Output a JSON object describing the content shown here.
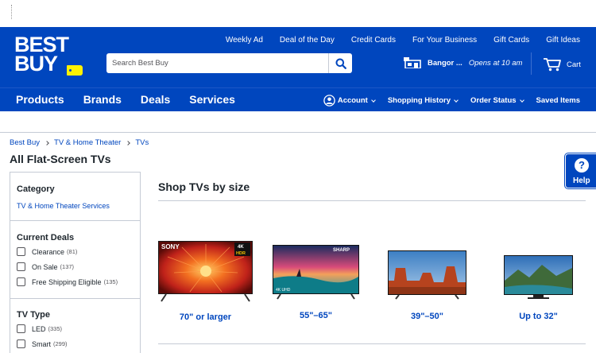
{
  "brand": {
    "logo_text_line1": "BEST",
    "logo_text_line2": "BUY",
    "brand_blue": "#0046be",
    "tag_yellow": "#fff200"
  },
  "utility_links": [
    "Weekly Ad",
    "Deal of the Day",
    "Credit Cards",
    "For Your Business",
    "Gift Cards",
    "Gift Ideas"
  ],
  "search": {
    "placeholder": "Search Best Buy",
    "button_icon": "search-icon"
  },
  "store": {
    "icon": "store-icon",
    "name": "Bangor ...",
    "hours": "Opens at 10 am"
  },
  "cart": {
    "icon": "cart-icon",
    "label": "Cart"
  },
  "nav": {
    "main": [
      "Products",
      "Brands",
      "Deals",
      "Services"
    ],
    "account": {
      "icon": "account-icon",
      "label": "Account"
    },
    "shopping_history": "Shopping History",
    "order_status": "Order Status",
    "saved_items": "Saved Items"
  },
  "breadcrumb": [
    "Best Buy",
    "TV & Home Theater",
    "TVs"
  ],
  "page_title": "All Flat-Screen TVs",
  "sidebar": {
    "category": {
      "title": "Category",
      "link": "TV & Home Theater Services"
    },
    "current_deals": {
      "title": "Current Deals",
      "options": [
        {
          "label": "Clearance",
          "count": "(81)"
        },
        {
          "label": "On Sale",
          "count": "(137)"
        },
        {
          "label": "Free Shipping Eligible",
          "count": "(135)"
        }
      ]
    },
    "tv_type": {
      "title": "TV Type",
      "options": [
        {
          "label": "LED",
          "count": "(335)"
        },
        {
          "label": "Smart",
          "count": "(299)"
        }
      ]
    }
  },
  "shop_by_size": {
    "title": "Shop TVs by size",
    "items": [
      {
        "label": "70\" or larger",
        "brand_text": "SONY",
        "badge_top": "4K",
        "badge_bottom": "HDR"
      },
      {
        "label": "55\"–65\"",
        "brand_text": "SHARP",
        "corner_text": "4K UHD"
      },
      {
        "label": "39\"–50\""
      },
      {
        "label": "Up to 32\""
      }
    ]
  },
  "help": {
    "icon": "help-icon",
    "symbol": "?",
    "label": "Help"
  }
}
